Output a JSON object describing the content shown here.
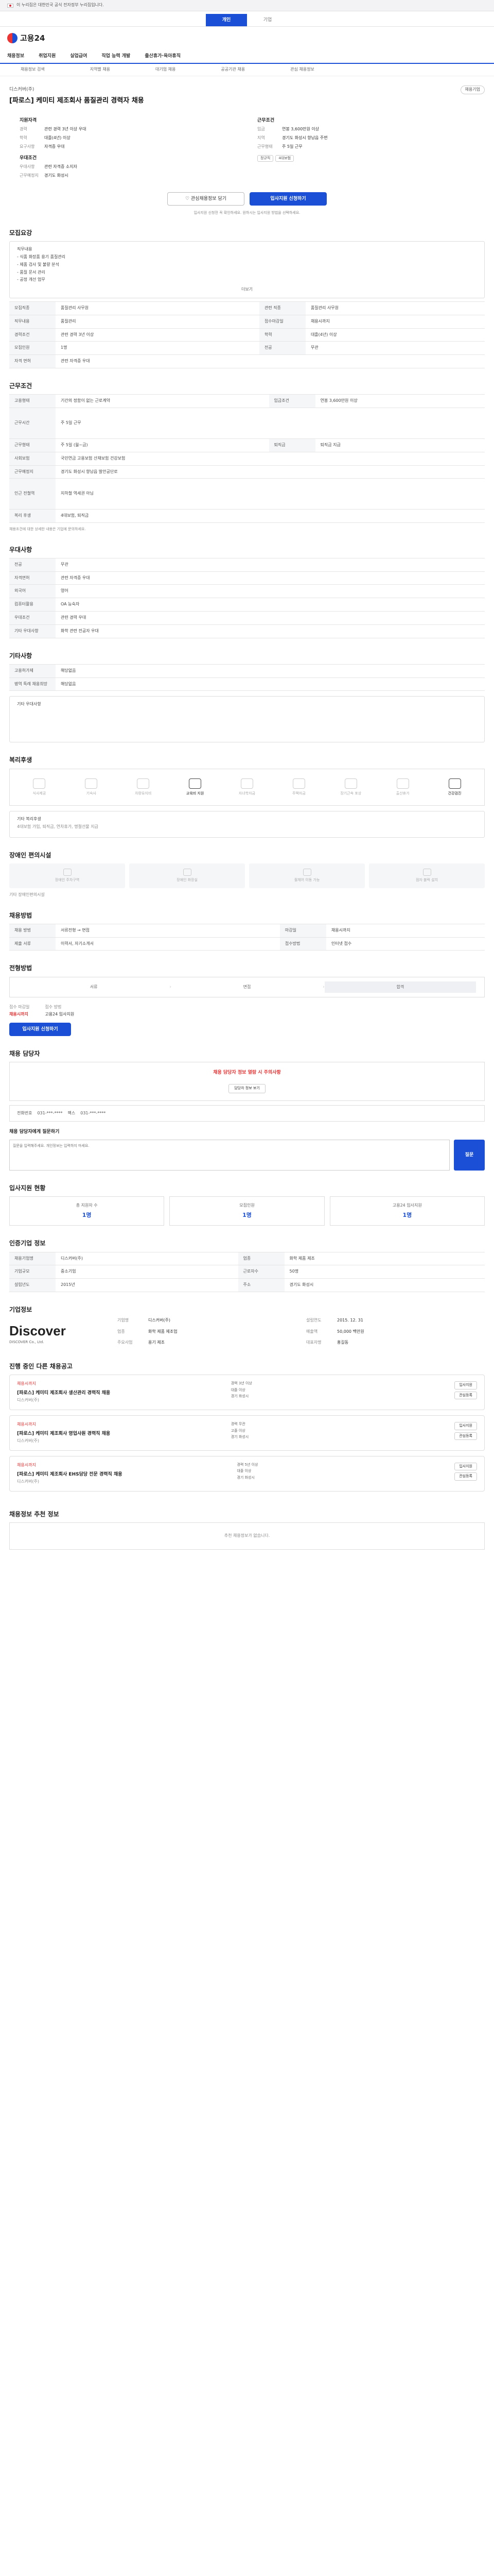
{
  "topbar": {
    "text": "이 누리집은 대한민국 공식 전자정부 누리집입니다."
  },
  "tabs": [
    "개인",
    "기업"
  ],
  "logo": "고용24",
  "gnb": [
    "채용정보",
    "취업지원",
    "실업급여",
    "직업 능력 개발",
    "출산휴가·육아휴직"
  ],
  "subnav": [
    "채용정보 검색",
    "지역별 채용",
    "대기업 채용",
    "공공기관 채용",
    "관심 채용정보"
  ],
  "job": {
    "company": "디스커버(주)",
    "badge": "채용기업",
    "title": "[파로스] 케미티 제조회사 품질관리 경력자 채용",
    "career_h": "지원자격",
    "cond_h": "근무조건",
    "career": [
      [
        "경력",
        "관련 경력 3년 이상 우대"
      ],
      [
        "학력",
        "대졸(4년) 이상"
      ],
      [
        "요구사항",
        "자격증 우대"
      ]
    ],
    "cond": [
      [
        "임금",
        "연봉 3,600만원 이상"
      ],
      [
        "지역",
        "경기도 화성시 향남읍 주변"
      ],
      [
        "근무형태",
        "주 5일 근무"
      ]
    ],
    "tags": [
      "정규직",
      "4대보험"
    ],
    "details_h": "우대조건",
    "details": [
      [
        "우대사항",
        "관련 자격증 소지자"
      ],
      [
        "근무예정지",
        "경기도 화성시"
      ]
    ],
    "btn_scrap": "관심채용정보 담기",
    "btn_apply": "입사지원 신청하기",
    "notice": "입사지원 신청전 꼭 확인하세요. 원하시는 입사지원 방법을 선택하세요."
  },
  "summary": {
    "title": "모집요강",
    "lines": [
      "직무내용",
      "- 식품 화장품 용기 품질관리",
      "- 제품 검사 및 불량 분석",
      "- 품질 문서 관리",
      "- 공정 개선 업무"
    ],
    "more": "더보기"
  },
  "req_rows": [
    [
      "모집직종",
      "품질관리 사무원"
    ],
    [
      "관련 직종",
      "품질관리 사무원"
    ],
    [
      "직무내용",
      "품질관리"
    ],
    [
      "접수마감일",
      "채용시까지"
    ],
    [
      "경력조건",
      "관련 경력 3년 이상"
    ],
    [
      "학력",
      "대졸(4년) 이상"
    ],
    [
      "모집인원",
      "1명"
    ],
    [
      "전공",
      "무관"
    ],
    [
      "자격 면허",
      "관련 자격증 우대"
    ]
  ],
  "work": {
    "title": "근무조건",
    "rows": [
      [
        "고용형태",
        "기간의 정함이 없는 근로계약"
      ],
      [
        "임금조건",
        "연봉 3,600만원 이상"
      ],
      [
        "근무시간",
        "주 5일 근무"
      ],
      [
        "근무형태",
        "주 5일 (월~금)"
      ],
      [
        "퇴직금",
        "퇴직금 지급"
      ],
      [
        "사회보험",
        "국민연금 고용보험 산재보험 건강보험"
      ],
      [
        "근무예정지",
        "경기도 화성시 향남읍 발안공단로"
      ],
      [
        "인근 전철역",
        "지하철 역세권 아님"
      ],
      [
        "복리 후생",
        "4대보험, 퇴직금"
      ]
    ],
    "note": "채용조건에 대한 상세한 내용은 기업에 문의하세요."
  },
  "extra": {
    "title": "우대사항",
    "rows": [
      [
        "전공",
        "무관"
      ],
      [
        "자격면허",
        "관련 자격증 우대"
      ],
      [
        "외국어",
        "영어"
      ],
      [
        "컴퓨터활용",
        "OA 능숙자"
      ],
      [
        "우대조건",
        "관련 경력 우대"
      ],
      [
        "기타 우대사항",
        "화학 관련 전공자 우대"
      ]
    ]
  },
  "misc": {
    "title": "기타사항",
    "rows": [
      [
        "고용허가제",
        "해당없음"
      ],
      [
        "병역 특례 채용희망",
        "해당없음"
      ]
    ],
    "extra": "기타 우대사항"
  },
  "welfare": {
    "title": "복리후생",
    "items": [
      "식사제공",
      "기숙사",
      "차량유지비",
      "교육비 지원",
      "자녀학자금",
      "주택자금",
      "장기근속 포상",
      "출산휴가",
      "건강검진"
    ],
    "on": [
      3,
      8
    ],
    "note": "기타 복리후생",
    "sub": "4대보험 가입, 퇴직금, 연차휴가, 명절선물 지급"
  },
  "facility": {
    "title": "장애인 편의시설",
    "items": [
      "장애인 주차구역",
      "장애인 화장실",
      "휠체어 이동 가능",
      "점자 블럭 설치"
    ],
    "note": "기타 장애인편의시설"
  },
  "method": {
    "title": "채용방법",
    "rows": [
      [
        "채용 방법",
        "서류전형 → 면접"
      ],
      [
        "마감일",
        "채용시까지"
      ],
      [
        "제출 서류",
        "이력서, 자기소개서"
      ],
      [
        "접수방법",
        "인터넷 접수"
      ]
    ]
  },
  "process": {
    "title": "전형방법",
    "steps": [
      "서류",
      "면접",
      "합격"
    ]
  },
  "receive": {
    "label1": "접수 마감일",
    "val1": "채용시까지",
    "label2": "접수 방법",
    "val2": "고용24 입사지원",
    "btn": "입사지원 신청하기"
  },
  "contact": {
    "title": "채용 담당자",
    "warn": "채용 담당자 정보 열람 시 주의사항",
    "tel_label": "전화번호",
    "tel": "031-***-****",
    "fax_label": "팩스",
    "fax": "031-***-****",
    "btn": "담당자 정보 보기"
  },
  "qa": {
    "title": "채용 담당자에게 질문하기",
    "placeholder": "질문을 입력해주세요. 개인정보는 입력하지 마세요.",
    "send": "질문"
  },
  "apply": {
    "title": "입사지원 현황",
    "stats": [
      [
        "총 지원자 수",
        "1명"
      ],
      [
        "모집인원",
        "1명"
      ],
      [
        "고용24 입사지원",
        "1명"
      ]
    ]
  },
  "info": {
    "title": "인증기업 정보",
    "rows": [
      [
        "채용기업명",
        "디스커버(주)"
      ],
      [
        "업종",
        "화학 제품 제조"
      ],
      [
        "기업규모",
        "중소기업"
      ],
      [
        "근로자수",
        "50명"
      ],
      [
        "설립년도",
        "2015년"
      ],
      [
        "주소",
        "경기도 화성시"
      ]
    ]
  },
  "company": {
    "title": "기업정보",
    "logo": "Discover",
    "logo_sub": "DISCOVER Co., Ltd.",
    "rows": [
      [
        "기업명",
        "디스커버(주)"
      ],
      [
        "설립연도",
        "2015. 12. 31"
      ],
      [
        "업종",
        "화학 제품 제조업"
      ],
      [
        "매출액",
        "50,000 백만원"
      ],
      [
        "주요사업",
        "용기 제조"
      ],
      [
        "대표자명",
        "홍길동"
      ]
    ]
  },
  "others": {
    "title": "진행 중인 다른 채용공고",
    "cards": [
      {
        "dday": "채용시까지",
        "title": "[파로스] 케미티 제조회사 생산관리 경력직 채용",
        "co": "디스커버(주)",
        "lines": [
          "경력 3년 이상",
          "대졸 이상",
          "경기 화성시"
        ],
        "btns": [
          "입사지원",
          "관심등록"
        ]
      },
      {
        "dday": "채용시까지",
        "title": "[파로스] 케미티 제조회사 영업사원 경력직 채용",
        "co": "디스커버(주)",
        "lines": [
          "경력 무관",
          "고졸 이상",
          "경기 화성시"
        ],
        "btns": [
          "입사지원",
          "관심등록"
        ]
      },
      {
        "dday": "채용시까지",
        "title": "[파로스] 케미티 제조회사 EHS담당 전문 경력직 채용",
        "co": "디스커버(주)",
        "lines": [
          "경력 5년 이상",
          "대졸 이상",
          "경기 화성시"
        ],
        "btns": [
          "입사지원",
          "관심등록"
        ]
      }
    ]
  },
  "recommend": {
    "title": "채용정보 추천 정보",
    "empty": "추천 채용정보가 없습니다."
  }
}
